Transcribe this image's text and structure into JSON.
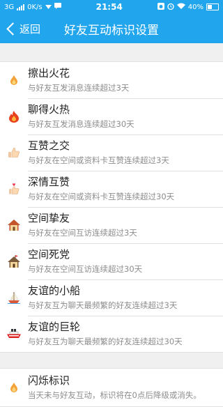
{
  "status_bar": {
    "network": "3G",
    "speed": "0K/s",
    "time": "21:54",
    "battery": "40%"
  },
  "nav": {
    "back_label": "返回",
    "title": "好友互动标识设置"
  },
  "items": [
    {
      "icon": "flame-small-icon",
      "title": "擦出火花",
      "desc": "与好友互发消息连续超过3天"
    },
    {
      "icon": "flame-big-icon",
      "title": "聊得火热",
      "desc": "与好友互发消息连续超过30天"
    },
    {
      "icon": "thumbs-up-icon",
      "title": "互赞之交",
      "desc": "与好友在空间或资料卡互赞连续超过3天"
    },
    {
      "icon": "heart-like-icon",
      "title": "深情互赞",
      "desc": "与好友在空间或资料卡互赞连续超过30天"
    },
    {
      "icon": "house-icon",
      "title": "空间挚友",
      "desc": "与好友在空间互访连续超过3天"
    },
    {
      "icon": "house-flag-icon",
      "title": "空间死党",
      "desc": "与好友在空间互访连续超过30天"
    },
    {
      "icon": "sailboat-icon",
      "title": "友谊的小船",
      "desc": "与好友互为聊天最频繁的好友连续超过3天"
    },
    {
      "icon": "ship-icon",
      "title": "友谊的巨轮",
      "desc": "与好友互为聊天最频繁的好友连续超过30天"
    }
  ],
  "flash": {
    "icon": "flame-small-icon",
    "title": "闪烁标识",
    "desc": "当天未与好友互动，标识将在0点后降级或消失。"
  }
}
